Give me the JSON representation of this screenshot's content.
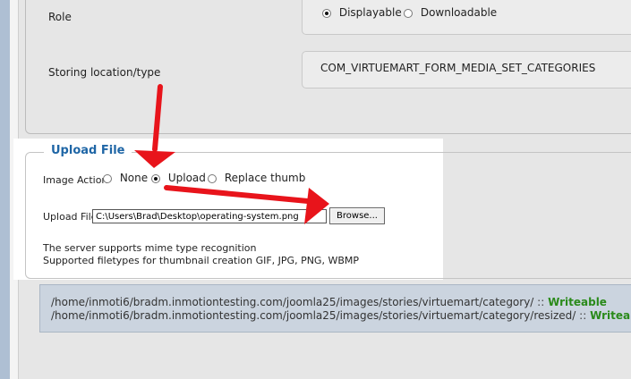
{
  "form": {
    "role": {
      "label": "Role",
      "options": [
        {
          "label": "Displayable",
          "checked": true
        },
        {
          "label": "Downloadable",
          "checked": false
        }
      ]
    },
    "storing_location": {
      "label": "Storing location/type",
      "value": "COM_VIRTUEMART_FORM_MEDIA_SET_CATEGORIES"
    }
  },
  "upload": {
    "legend": "Upload File",
    "image_action": {
      "label": "Image Action",
      "options": [
        {
          "label": "None",
          "checked": false
        },
        {
          "label": "Upload",
          "checked": true
        },
        {
          "label": "Replace thumb",
          "checked": false
        }
      ]
    },
    "file": {
      "label": "Upload File",
      "value": "C:\\Users\\Brad\\Desktop\\operating-system.png",
      "browse_label": "Browse..."
    },
    "info": [
      "The server supports mime type recognition",
      "Supported filetypes for thumbnail creation GIF, JPG, PNG, WBMP"
    ]
  },
  "paths": [
    {
      "path": "/home/inmoti6/bradm.inmotiontesting.com/joomla25/images/stories/virtuemart/category/",
      "sep": " :: ",
      "status": "Writeable"
    },
    {
      "path": "/home/inmoti6/bradm.inmotiontesting.com/joomla25/images/stories/virtuemart/category/resized/",
      "sep": " :: ",
      "status": "Writeable"
    }
  ],
  "colors": {
    "legend": "#1f66a6",
    "writeable": "#2a8a1a",
    "annotation_arrow": "#e8141b",
    "highlight": "#ffffff"
  }
}
